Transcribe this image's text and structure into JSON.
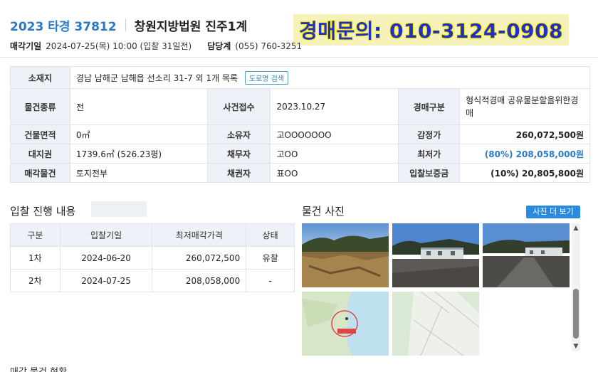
{
  "header": {
    "case_no": "2023 타경 37812",
    "court": "창원지방법원 진주1계",
    "banner": "경매문의: 010-3124-0908"
  },
  "meta": {
    "sale_date_label": "매각기일",
    "sale_date_value": "2024-07-25(목) 10:00 (입찰 31일전)",
    "dept_label": "담당계",
    "dept_value": "(055) 760-3251"
  },
  "info": {
    "location_label": "소재지",
    "location_value": "경남 남해군 남해읍 선소리 31-7 외 1개 목록",
    "road_button": "도로명 검색",
    "type_label": "물건종류",
    "type_value": "전",
    "receipt_label": "사건접수",
    "receipt_value": "2023.10.27",
    "auction_type_label": "경매구분",
    "auction_type_value": "형식적경매 공유물분할을위한경매",
    "building_area_label": "건물면적",
    "building_area_value": "0㎡",
    "owner_label": "소유자",
    "owner_value": "고OOOOOOO",
    "appraisal_label": "감정가",
    "appraisal_value": "260,072,500원",
    "land_label": "대지권",
    "land_value": "1739.6㎡ (526.23평)",
    "debtor_label": "채무자",
    "debtor_value": "고OO",
    "min_price_label": "최저가",
    "min_price_value": "(80%) 208,058,000원",
    "sale_item_label": "매각물건",
    "sale_item_value": "토지전부",
    "creditor_label": "채권자",
    "creditor_value": "표OO",
    "deposit_label": "입찰보증금",
    "deposit_value": "(10%) 20,805,800원"
  },
  "bid_section": {
    "title": "입찰 진행 내용",
    "headers": [
      "구분",
      "입찰기일",
      "최저매각가격",
      "상태"
    ],
    "rows": [
      [
        "1차",
        "2024-06-20",
        "260,072,500",
        "유찰"
      ],
      [
        "2차",
        "2024-07-25",
        "208,058,000",
        "-"
      ]
    ]
  },
  "photo_section": {
    "title": "물건 사진",
    "more_button": "사진 더 보기"
  },
  "bottom": {
    "title": "매각 물건 현황"
  },
  "colors": {
    "accent": "#2a7ac8",
    "header_bg": "#eef2f8",
    "border": "#e0e3e8",
    "banner_text": "#1f2fc8",
    "banner_bg": "#f4f2b8"
  }
}
